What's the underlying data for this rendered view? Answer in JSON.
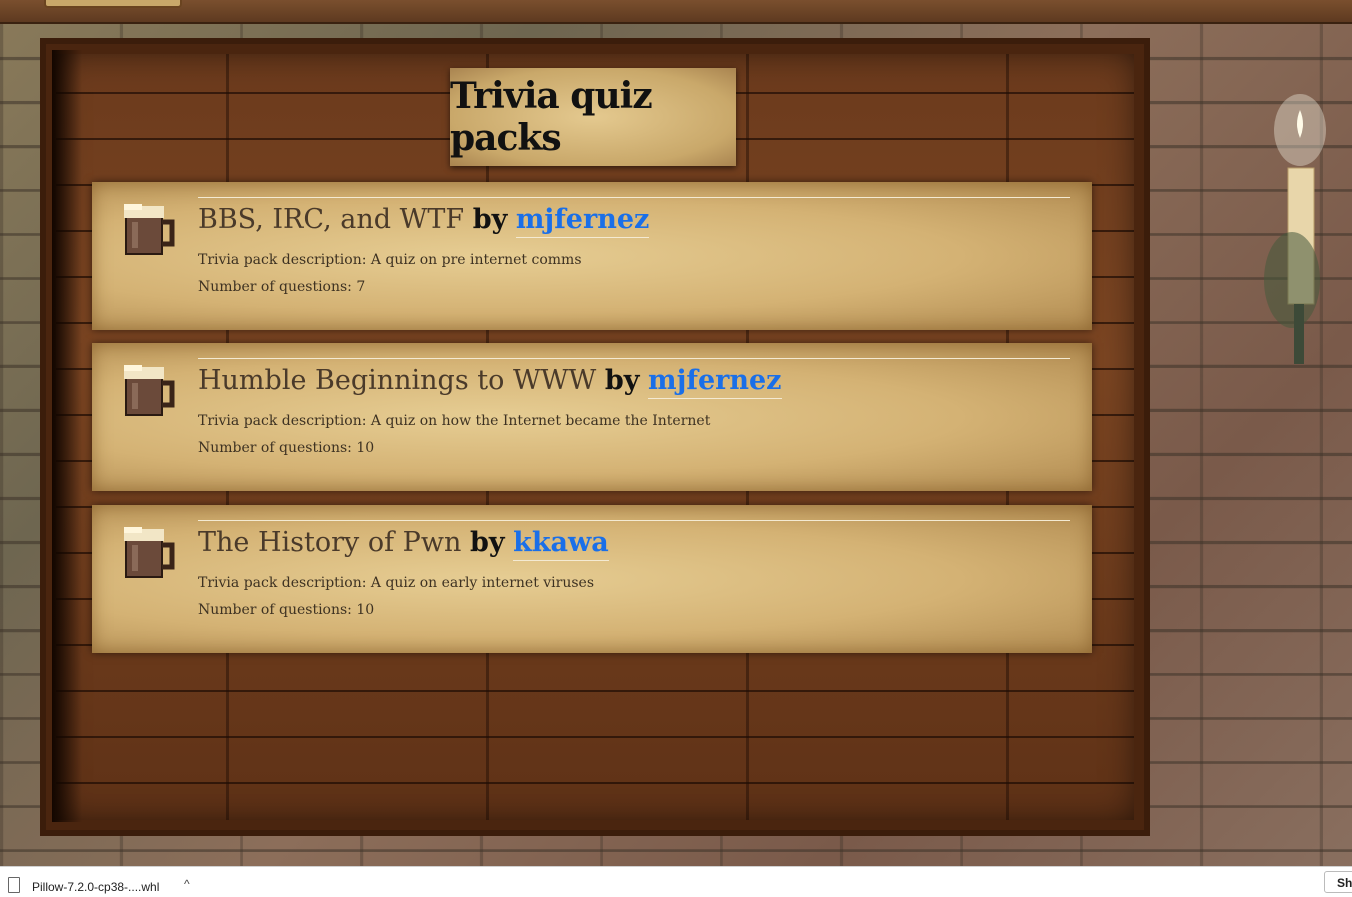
{
  "page": {
    "title": "Trivia quiz packs"
  },
  "packs": [
    {
      "name": "BBS, IRC, and WTF",
      "by": "by",
      "author": "mjfernez",
      "description": "Trivia pack description: A quiz on pre internet comms",
      "questions": "Number of questions: 7"
    },
    {
      "name": "Humble Beginnings to WWW",
      "by": "by",
      "author": "mjfernez",
      "description": "Trivia pack description: A quiz on how the Internet became the Internet",
      "questions": "Number of questions: 10"
    },
    {
      "name": "The History of Pwn",
      "by": "by",
      "author": "kkawa",
      "description": "Trivia pack description: A quiz on early internet viruses",
      "questions": "Number of questions: 10"
    }
  ],
  "icons": {
    "pack_icon": "beer-mug-icon",
    "wall_decor": "candle-icon",
    "download_file": "file-icon",
    "download_menu": "chevron-up-icon"
  },
  "colors": {
    "author_link": "#1a6fe8",
    "parchment": "#d4b274",
    "wood": "#6b3a1c"
  },
  "download_bar": {
    "file_name": "Pillow-7.2.0-cp38-....whl",
    "chevron": "^",
    "show_all": "Sh"
  }
}
